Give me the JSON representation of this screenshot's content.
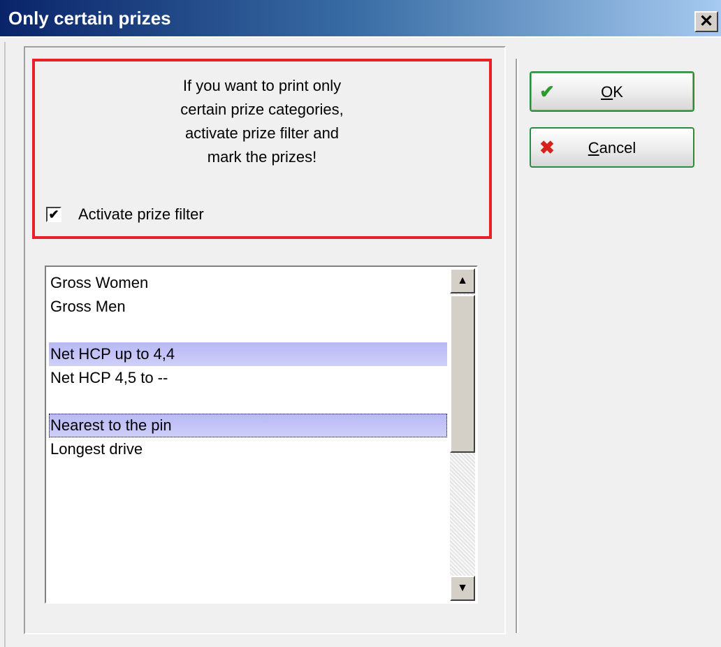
{
  "window": {
    "title": "Only certain prizes",
    "close_glyph": "✕"
  },
  "info": {
    "lines": [
      "If you want to print only",
      "certain prize categories,",
      "activate prize filter and",
      "mark the prizes!"
    ],
    "filter_checkbox": {
      "label": "Activate prize filter",
      "checked": true
    }
  },
  "prize_list": {
    "items": [
      {
        "label": "Gross Women",
        "selected": false
      },
      {
        "label": "Gross Men",
        "selected": false
      },
      {
        "label": "",
        "selected": false
      },
      {
        "label": "Net HCP up to 4,4",
        "selected": true
      },
      {
        "label": "Net HCP 4,5 to --",
        "selected": false
      },
      {
        "label": "",
        "selected": false
      },
      {
        "label": "Nearest to the pin",
        "selected": true,
        "focused": true
      },
      {
        "label": "Longest drive",
        "selected": false
      }
    ],
    "scroll_up_glyph": "▲",
    "scroll_down_glyph": "▼"
  },
  "buttons": {
    "ok": {
      "mnemonic": "O",
      "rest": "K",
      "icon": "check-icon",
      "icon_glyph": "✔",
      "icon_color": "#2e9a2e"
    },
    "cancel": {
      "mnemonic": "C",
      "rest": "ancel",
      "icon": "cross-icon",
      "icon_glyph": "✖",
      "icon_color": "#d8201c"
    }
  },
  "colors": {
    "highlight_border": "#e8202a",
    "button_border": "#2e8b3c",
    "selection": "#c4c4f8"
  }
}
